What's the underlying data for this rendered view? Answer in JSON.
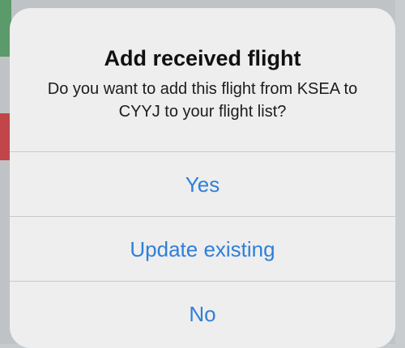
{
  "dialog": {
    "title": "Add received flight",
    "message": "Do you want to add this flight from KSEA to CYYJ to your flight list?",
    "buttons": [
      {
        "label": "Yes"
      },
      {
        "label": "Update existing"
      },
      {
        "label": "No"
      }
    ]
  },
  "colors": {
    "button_text": "#2f7fd8",
    "dialog_background": "#eeeeee",
    "backdrop": "#bfc3c6"
  }
}
